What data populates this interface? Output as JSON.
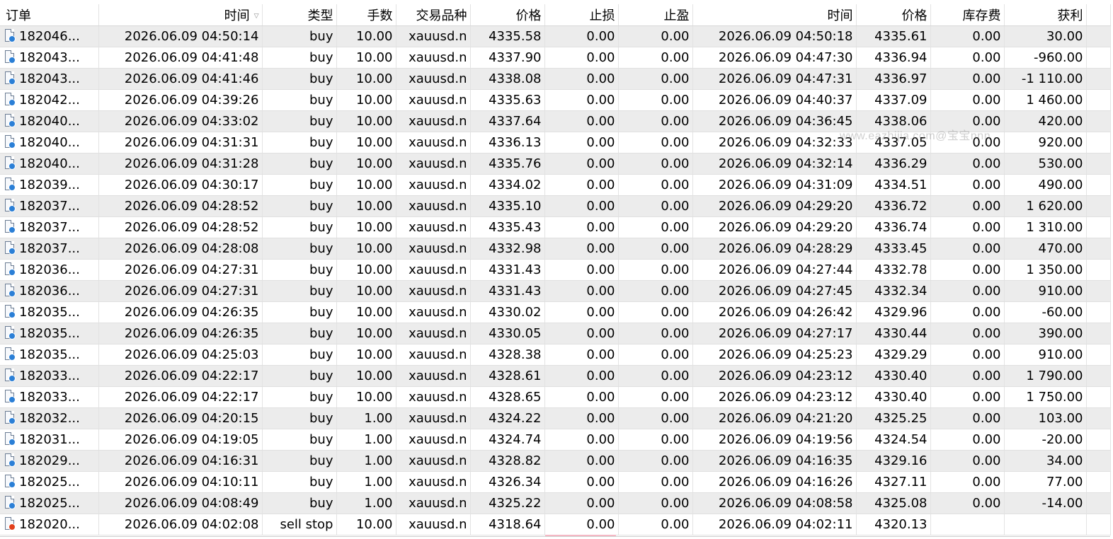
{
  "headers": {
    "order": "订单",
    "time_open": "时间",
    "sort_glyph": "▽",
    "type": "类型",
    "lots": "手数",
    "symbol": "交易品种",
    "price_open": "价格",
    "sl": "止损",
    "tp": "止盈",
    "time_close": "时间",
    "price_close": "价格",
    "swap": "库存费",
    "profit": "获利"
  },
  "watermark": "www.eazhijia.com@宝宝nnn",
  "rows": [
    {
      "order": "182046...",
      "time_open": "2026.06.09 04:50:14",
      "type": "buy",
      "lots": "10.00",
      "symbol": "xauusd.n",
      "price_open": "4335.58",
      "sl": "0.00",
      "tp": "0.00",
      "time_close": "2026.06.09 04:50:18",
      "price_close": "4335.61",
      "swap": "0.00",
      "profit": "30.00",
      "icon": "closed-order-icon"
    },
    {
      "order": "182043...",
      "time_open": "2026.06.09 04:41:48",
      "type": "buy",
      "lots": "10.00",
      "symbol": "xauusd.n",
      "price_open": "4337.90",
      "sl": "0.00",
      "tp": "0.00",
      "time_close": "2026.06.09 04:47:30",
      "price_close": "4336.94",
      "swap": "0.00",
      "profit": "-960.00",
      "icon": "closed-order-icon"
    },
    {
      "order": "182043...",
      "time_open": "2026.06.09 04:41:46",
      "type": "buy",
      "lots": "10.00",
      "symbol": "xauusd.n",
      "price_open": "4338.08",
      "sl": "0.00",
      "tp": "0.00",
      "time_close": "2026.06.09 04:47:31",
      "price_close": "4336.97",
      "swap": "0.00",
      "profit": "-1 110.00",
      "icon": "closed-order-icon"
    },
    {
      "order": "182042...",
      "time_open": "2026.06.09 04:39:26",
      "type": "buy",
      "lots": "10.00",
      "symbol": "xauusd.n",
      "price_open": "4335.63",
      "sl": "0.00",
      "tp": "0.00",
      "time_close": "2026.06.09 04:40:37",
      "price_close": "4337.09",
      "swap": "0.00",
      "profit": "1 460.00",
      "icon": "closed-order-icon"
    },
    {
      "order": "182040...",
      "time_open": "2026.06.09 04:33:02",
      "type": "buy",
      "lots": "10.00",
      "symbol": "xauusd.n",
      "price_open": "4337.64",
      "sl": "0.00",
      "tp": "0.00",
      "time_close": "2026.06.09 04:36:45",
      "price_close": "4338.06",
      "swap": "0.00",
      "profit": "420.00",
      "icon": "closed-order-icon"
    },
    {
      "order": "182040...",
      "time_open": "2026.06.09 04:31:31",
      "type": "buy",
      "lots": "10.00",
      "symbol": "xauusd.n",
      "price_open": "4336.13",
      "sl": "0.00",
      "tp": "0.00",
      "time_close": "2026.06.09 04:32:33",
      "price_close": "4337.05",
      "swap": "0.00",
      "profit": "920.00",
      "icon": "closed-order-icon"
    },
    {
      "order": "182040...",
      "time_open": "2026.06.09 04:31:28",
      "type": "buy",
      "lots": "10.00",
      "symbol": "xauusd.n",
      "price_open": "4335.76",
      "sl": "0.00",
      "tp": "0.00",
      "time_close": "2026.06.09 04:32:14",
      "price_close": "4336.29",
      "swap": "0.00",
      "profit": "530.00",
      "icon": "closed-order-icon"
    },
    {
      "order": "182039...",
      "time_open": "2026.06.09 04:30:17",
      "type": "buy",
      "lots": "10.00",
      "symbol": "xauusd.n",
      "price_open": "4334.02",
      "sl": "0.00",
      "tp": "0.00",
      "time_close": "2026.06.09 04:31:09",
      "price_close": "4334.51",
      "swap": "0.00",
      "profit": "490.00",
      "icon": "closed-order-icon"
    },
    {
      "order": "182037...",
      "time_open": "2026.06.09 04:28:52",
      "type": "buy",
      "lots": "10.00",
      "symbol": "xauusd.n",
      "price_open": "4335.10",
      "sl": "0.00",
      "tp": "0.00",
      "time_close": "2026.06.09 04:29:20",
      "price_close": "4336.72",
      "swap": "0.00",
      "profit": "1 620.00",
      "icon": "closed-order-icon"
    },
    {
      "order": "182037...",
      "time_open": "2026.06.09 04:28:52",
      "type": "buy",
      "lots": "10.00",
      "symbol": "xauusd.n",
      "price_open": "4335.43",
      "sl": "0.00",
      "tp": "0.00",
      "time_close": "2026.06.09 04:29:20",
      "price_close": "4336.74",
      "swap": "0.00",
      "profit": "1 310.00",
      "icon": "closed-order-icon"
    },
    {
      "order": "182037...",
      "time_open": "2026.06.09 04:28:08",
      "type": "buy",
      "lots": "10.00",
      "symbol": "xauusd.n",
      "price_open": "4332.98",
      "sl": "0.00",
      "tp": "0.00",
      "time_close": "2026.06.09 04:28:29",
      "price_close": "4333.45",
      "swap": "0.00",
      "profit": "470.00",
      "icon": "closed-order-icon"
    },
    {
      "order": "182036...",
      "time_open": "2026.06.09 04:27:31",
      "type": "buy",
      "lots": "10.00",
      "symbol": "xauusd.n",
      "price_open": "4331.43",
      "sl": "0.00",
      "tp": "0.00",
      "time_close": "2026.06.09 04:27:44",
      "price_close": "4332.78",
      "swap": "0.00",
      "profit": "1 350.00",
      "icon": "closed-order-icon"
    },
    {
      "order": "182036...",
      "time_open": "2026.06.09 04:27:31",
      "type": "buy",
      "lots": "10.00",
      "symbol": "xauusd.n",
      "price_open": "4331.43",
      "sl": "0.00",
      "tp": "0.00",
      "time_close": "2026.06.09 04:27:45",
      "price_close": "4332.34",
      "swap": "0.00",
      "profit": "910.00",
      "icon": "closed-order-icon"
    },
    {
      "order": "182035...",
      "time_open": "2026.06.09 04:26:35",
      "type": "buy",
      "lots": "10.00",
      "symbol": "xauusd.n",
      "price_open": "4330.02",
      "sl": "0.00",
      "tp": "0.00",
      "time_close": "2026.06.09 04:26:42",
      "price_close": "4329.96",
      "swap": "0.00",
      "profit": "-60.00",
      "icon": "closed-order-icon"
    },
    {
      "order": "182035...",
      "time_open": "2026.06.09 04:26:35",
      "type": "buy",
      "lots": "10.00",
      "symbol": "xauusd.n",
      "price_open": "4330.05",
      "sl": "0.00",
      "tp": "0.00",
      "time_close": "2026.06.09 04:27:17",
      "price_close": "4330.44",
      "swap": "0.00",
      "profit": "390.00",
      "icon": "closed-order-icon"
    },
    {
      "order": "182035...",
      "time_open": "2026.06.09 04:25:03",
      "type": "buy",
      "lots": "10.00",
      "symbol": "xauusd.n",
      "price_open": "4328.38",
      "sl": "0.00",
      "tp": "0.00",
      "time_close": "2026.06.09 04:25:23",
      "price_close": "4329.29",
      "swap": "0.00",
      "profit": "910.00",
      "icon": "closed-order-icon"
    },
    {
      "order": "182033...",
      "time_open": "2026.06.09 04:22:17",
      "type": "buy",
      "lots": "10.00",
      "symbol": "xauusd.n",
      "price_open": "4328.61",
      "sl": "0.00",
      "tp": "0.00",
      "time_close": "2026.06.09 04:23:12",
      "price_close": "4330.40",
      "swap": "0.00",
      "profit": "1 790.00",
      "icon": "closed-order-icon"
    },
    {
      "order": "182033...",
      "time_open": "2026.06.09 04:22:17",
      "type": "buy",
      "lots": "10.00",
      "symbol": "xauusd.n",
      "price_open": "4328.65",
      "sl": "0.00",
      "tp": "0.00",
      "time_close": "2026.06.09 04:23:12",
      "price_close": "4330.40",
      "swap": "0.00",
      "profit": "1 750.00",
      "icon": "closed-order-icon"
    },
    {
      "order": "182032...",
      "time_open": "2026.06.09 04:20:15",
      "type": "buy",
      "lots": "1.00",
      "symbol": "xauusd.n",
      "price_open": "4324.22",
      "sl": "0.00",
      "tp": "0.00",
      "time_close": "2026.06.09 04:21:20",
      "price_close": "4325.25",
      "swap": "0.00",
      "profit": "103.00",
      "icon": "closed-order-icon"
    },
    {
      "order": "182031...",
      "time_open": "2026.06.09 04:19:05",
      "type": "buy",
      "lots": "1.00",
      "symbol": "xauusd.n",
      "price_open": "4324.74",
      "sl": "0.00",
      "tp": "0.00",
      "time_close": "2026.06.09 04:19:56",
      "price_close": "4324.54",
      "swap": "0.00",
      "profit": "-20.00",
      "icon": "closed-order-icon"
    },
    {
      "order": "182029...",
      "time_open": "2026.06.09 04:16:31",
      "type": "buy",
      "lots": "1.00",
      "symbol": "xauusd.n",
      "price_open": "4328.82",
      "sl": "0.00",
      "tp": "0.00",
      "time_close": "2026.06.09 04:16:35",
      "price_close": "4329.16",
      "swap": "0.00",
      "profit": "34.00",
      "icon": "closed-order-icon"
    },
    {
      "order": "182025...",
      "time_open": "2026.06.09 04:10:11",
      "type": "buy",
      "lots": "1.00",
      "symbol": "xauusd.n",
      "price_open": "4326.34",
      "sl": "0.00",
      "tp": "0.00",
      "time_close": "2026.06.09 04:16:26",
      "price_close": "4327.11",
      "swap": "0.00",
      "profit": "77.00",
      "icon": "closed-order-icon"
    },
    {
      "order": "182025...",
      "time_open": "2026.06.09 04:08:49",
      "type": "buy",
      "lots": "1.00",
      "symbol": "xauusd.n",
      "price_open": "4325.22",
      "sl": "0.00",
      "tp": "0.00",
      "time_close": "2026.06.09 04:08:58",
      "price_close": "4325.08",
      "swap": "0.00",
      "profit": "-14.00",
      "icon": "closed-order-icon"
    },
    {
      "order": "182020...",
      "time_open": "2026.06.09 04:02:08",
      "type": "sell stop",
      "lots": "10.00",
      "symbol": "xauusd.n",
      "price_open": "4318.64",
      "sl": "0.00",
      "tp": "0.00",
      "time_close": "2026.06.09 04:02:11",
      "price_close": "4320.13",
      "swap": "",
      "profit": "",
      "icon": "cancelled-order-icon"
    }
  ],
  "colors": {
    "row_alt": "#ececec",
    "row_normal": "#ffffff",
    "icon_dot_closed": "#2b7fd6",
    "icon_dot_cancelled": "#e2401c"
  }
}
